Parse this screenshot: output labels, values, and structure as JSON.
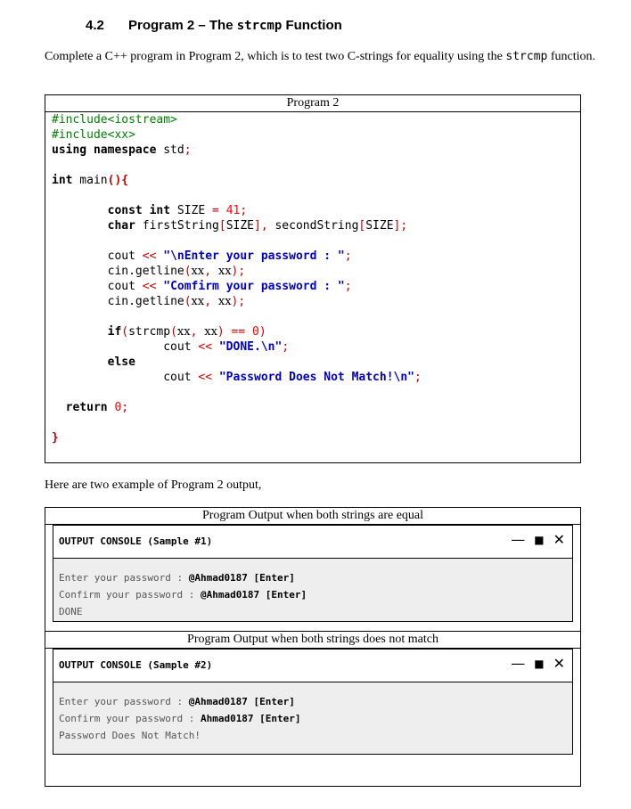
{
  "heading": {
    "number": "4.2",
    "title_prefix": "Program 2 – The ",
    "title_code": "strcmp",
    "title_suffix": " Function"
  },
  "intro": {
    "text_before": "Complete a C++ program in Program 2, which is to test two C-strings for equality using the ",
    "code": "strcmp",
    "text_after": " function."
  },
  "program_box": {
    "title": "Program 2",
    "code": {
      "include1": "#include<iostream>",
      "include2_prefix": "#include<",
      "include2_xx": "xx",
      "include2_suffix": ">",
      "using_kw": "using namespace",
      "using_rest": " std",
      "semicolon": ";",
      "int_kw": "int",
      "main": " main",
      "paren_brace": "(){",
      "const_int": "const int",
      "size_decl": " SIZE ",
      "eq": "=",
      "size_val": " 41",
      "char_kw": "char",
      "first_string": " firstString",
      "lb": "[",
      "size_ref": "SIZE",
      "rb": "]",
      "comma": ", ",
      "second_string": "secondString",
      "cout": "cout ",
      "shl": "<<",
      "str_enter": " \"\\nEnter your password : \"",
      "cin_getline": "cin.getline",
      "lp": "(",
      "xx": "xx",
      "rp": ")",
      "str_confirm": " \"Comfirm your password : \"",
      "if_kw": "if",
      "strcmp": "strcmp",
      "eqeq": " == ",
      "zero": "0",
      "str_done": " \"DONE.\\n\"",
      "else_kw": "else",
      "str_nomatch": " \"Password Does Not Match!\\n\"",
      "return_kw": "return",
      "return_val": " 0",
      "close_brace": "}"
    }
  },
  "outro": "Here are two example of Program 2 output,",
  "output_box": {
    "title1": "Program Output when both strings are equal",
    "title2": "Program Output when both strings does not match",
    "console1": {
      "label": "OUTPUT CONSOLE (Sample #1)",
      "line1_prompt": "Enter your password : ",
      "line1_input": "@Ahmad0187 [Enter]",
      "line2_prompt": "Confirm your password : ",
      "line2_input": "@Ahmad0187 [Enter]",
      "line3": "DONE"
    },
    "console2": {
      "label": "OUTPUT CONSOLE (Sample #2)",
      "line1_prompt": "Enter your password : ",
      "line1_input": "@Ahmad0187 [Enter]",
      "line2_prompt": "Confirm your password : ",
      "line2_input": "Ahmad0187 [Enter]",
      "line3": "Password Does Not Match!"
    },
    "controls": {
      "minimize": "—",
      "maximize": "■",
      "close": "✕"
    }
  }
}
